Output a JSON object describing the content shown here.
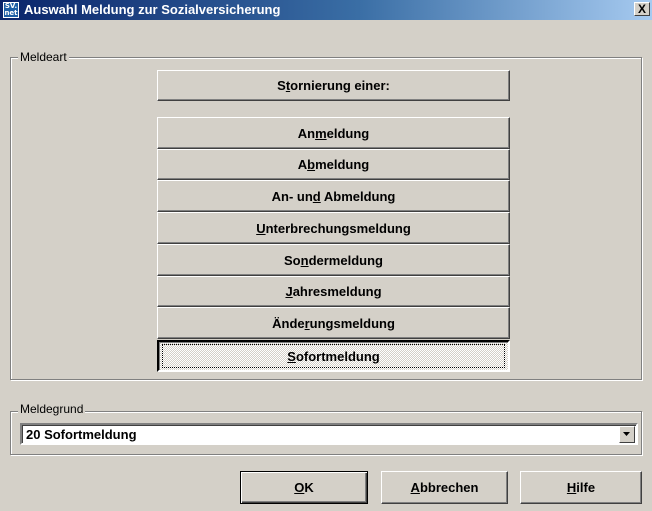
{
  "window": {
    "title": "Auswahl Meldung zur Sozialversicherung",
    "icon": {
      "name": "svnet-icon",
      "line1": "SV.",
      "line2": "net"
    },
    "close_label": "X"
  },
  "meldeart": {
    "label": "Meldeart",
    "stornierung": {
      "pre": "S",
      "ul": "t",
      "post": "ornierung einer:"
    },
    "buttons": [
      {
        "pre": "An",
        "ul": "m",
        "post": "eldung"
      },
      {
        "pre": "A",
        "ul": "b",
        "post": "meldung"
      },
      {
        "pre": "An- un",
        "ul": "d",
        "post": " Abmeldung"
      },
      {
        "pre": "",
        "ul": "U",
        "post": "nterbrechungsmeldung"
      },
      {
        "pre": "So",
        "ul": "n",
        "post": "dermeldung"
      },
      {
        "pre": "",
        "ul": "J",
        "post": "ahresmeldung"
      },
      {
        "pre": "Ände",
        "ul": "r",
        "post": "ungsmeldung"
      },
      {
        "pre": "",
        "ul": "S",
        "post": "ofortmeldung"
      }
    ]
  },
  "meldegrund": {
    "label": "Meldegrund",
    "selected": "20 Sofortmeldung"
  },
  "footer": {
    "ok": {
      "pre": "",
      "ul": "O",
      "post": "K"
    },
    "abbrechen": {
      "pre": "",
      "ul": "A",
      "post": "bbrechen"
    },
    "hilfe": {
      "pre": "",
      "ul": "H",
      "post": "ilfe"
    }
  }
}
